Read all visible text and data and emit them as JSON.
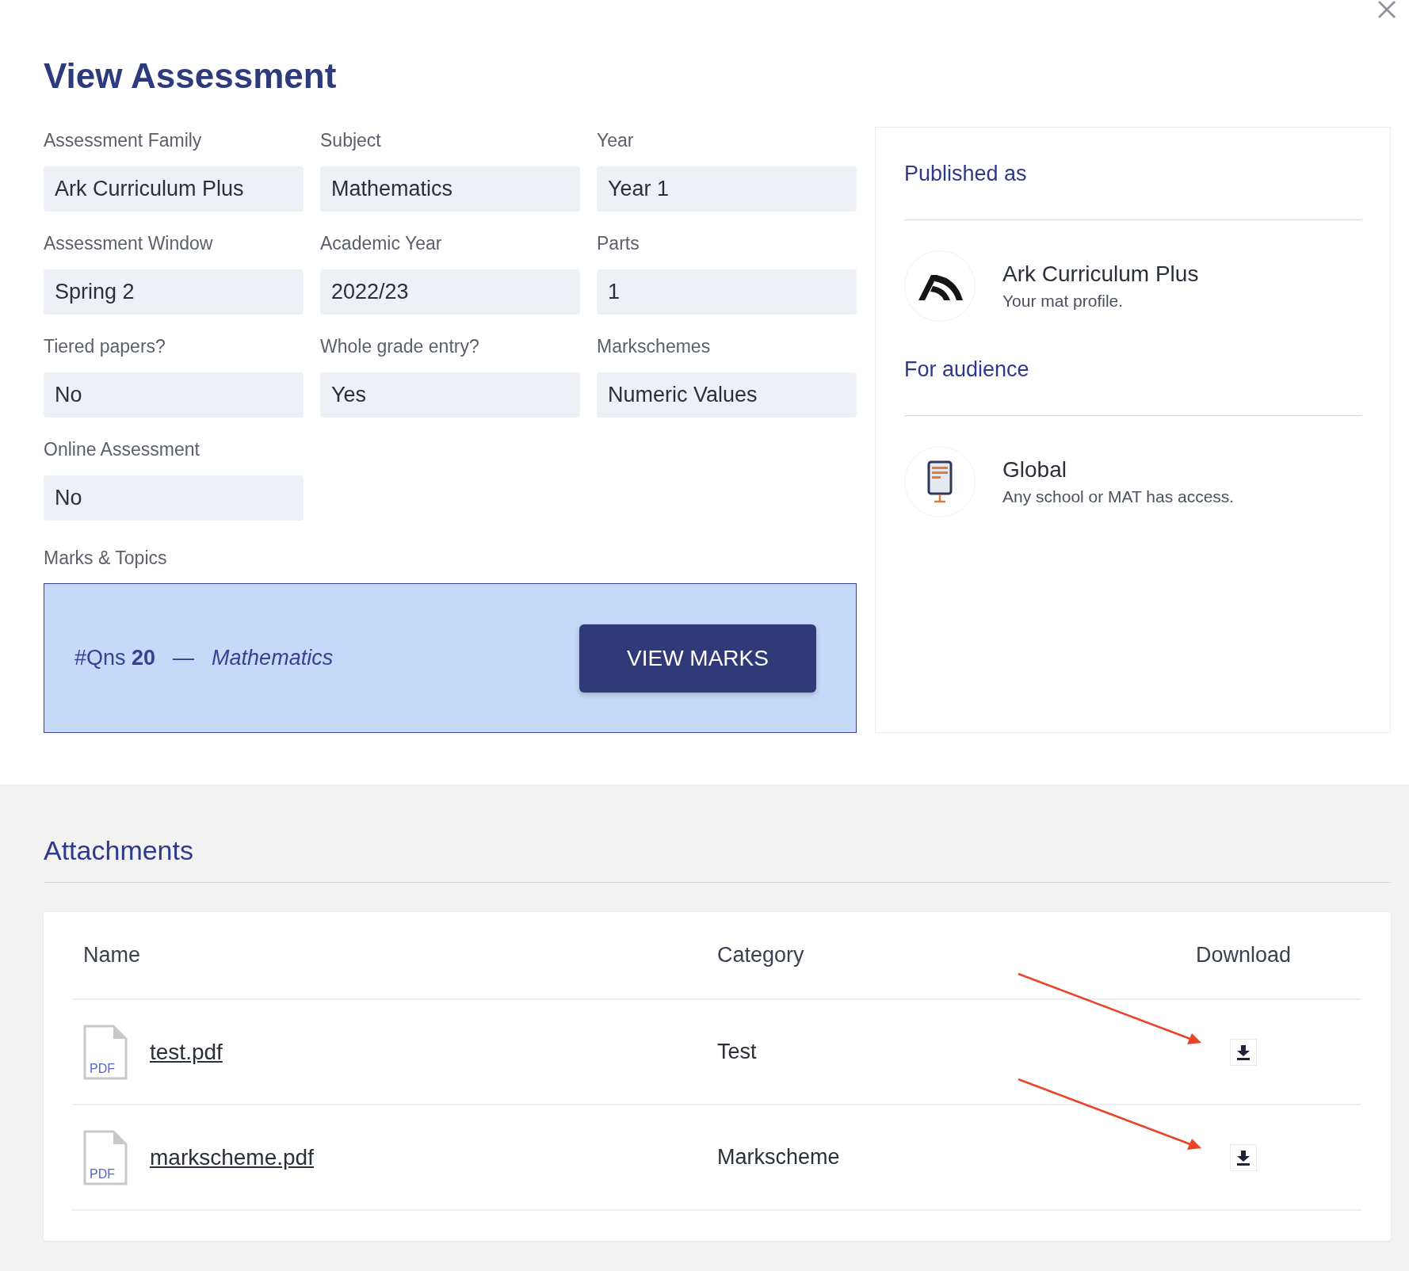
{
  "title": "View Assessment",
  "fields": [
    {
      "label": "Assessment Family",
      "value": "Ark Curriculum Plus"
    },
    {
      "label": "Subject",
      "value": "Mathematics"
    },
    {
      "label": "Year",
      "value": "Year 1"
    },
    {
      "label": "Assessment Window",
      "value": "Spring 2"
    },
    {
      "label": "Academic Year",
      "value": "2022/23"
    },
    {
      "label": "Parts",
      "value": "1"
    },
    {
      "label": "Tiered papers?",
      "value": "No"
    },
    {
      "label": "Whole grade entry?",
      "value": "Yes"
    },
    {
      "label": "Markschemes",
      "value": "Numeric Values"
    },
    {
      "label": "Online Assessment",
      "value": "No"
    }
  ],
  "marks_topics": {
    "label": "Marks & Topics",
    "summary": "#Qns **20**",
    "separator": "—",
    "subject": "Mathematics",
    "button": "VIEW MARKS"
  },
  "published_as": {
    "heading": "Published as",
    "name": "Ark Curriculum Plus",
    "description": "Your mat profile."
  },
  "audience": {
    "heading": "For audience",
    "name": "Global",
    "description": "Any school or MAT has access."
  },
  "attachments": {
    "title": "Attachments",
    "columns": [
      "Name",
      "Category",
      "Download"
    ],
    "rows": [
      {
        "file_type": "PDF",
        "name": "test.pdf",
        "category": "Test",
        "highlighted": true
      },
      {
        "file_type": "PDF",
        "name": "markscheme.pdf",
        "category": "Markscheme",
        "highlighted": true
      }
    ]
  }
}
